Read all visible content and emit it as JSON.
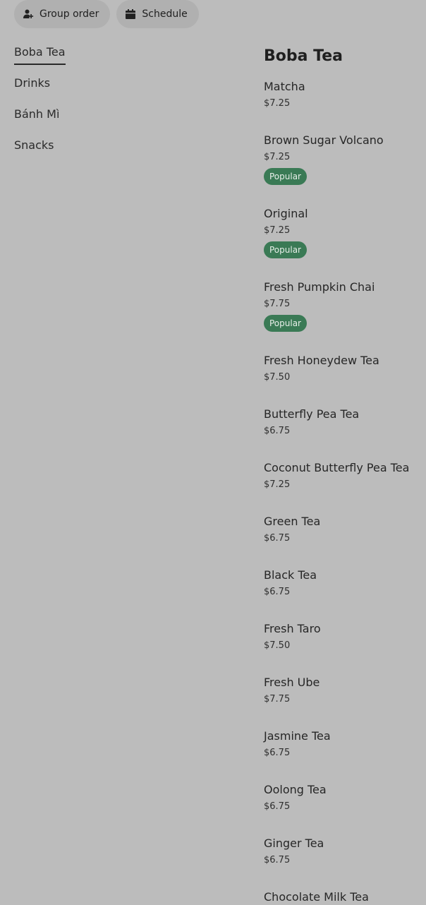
{
  "header": {
    "group_order_label": "Group order",
    "schedule_label": "Schedule"
  },
  "sidebar": {
    "items": [
      {
        "label": "Boba Tea",
        "active": true
      },
      {
        "label": "Drinks",
        "active": false
      },
      {
        "label": "Bánh Mì",
        "active": false
      },
      {
        "label": "Snacks",
        "active": false
      }
    ]
  },
  "menu": {
    "section_title": "Boba Tea",
    "items": [
      {
        "name": "Matcha",
        "price": "$7.25",
        "badge": ""
      },
      {
        "name": "Brown Sugar Volcano",
        "price": "$7.25",
        "badge": "Popular"
      },
      {
        "name": "Original",
        "price": "$7.25",
        "badge": "Popular"
      },
      {
        "name": "Fresh Pumpkin Chai",
        "price": "$7.75",
        "badge": "Popular"
      },
      {
        "name": "Fresh Honeydew Tea",
        "price": "$7.50",
        "badge": ""
      },
      {
        "name": "Butterfly Pea Tea",
        "price": "$6.75",
        "badge": ""
      },
      {
        "name": "Coconut Butterfly Pea Tea",
        "price": "$7.25",
        "badge": ""
      },
      {
        "name": "Green Tea",
        "price": "$6.75",
        "badge": ""
      },
      {
        "name": "Black Tea",
        "price": "$6.75",
        "badge": ""
      },
      {
        "name": "Fresh Taro",
        "price": "$7.50",
        "badge": ""
      },
      {
        "name": "Fresh Ube",
        "price": "$7.75",
        "badge": ""
      },
      {
        "name": "Jasmine Tea",
        "price": "$6.75",
        "badge": ""
      },
      {
        "name": "Oolong Tea",
        "price": "$6.75",
        "badge": ""
      },
      {
        "name": "Ginger Tea",
        "price": "$6.75",
        "badge": ""
      },
      {
        "name": "Chocolate Milk Tea",
        "price": "",
        "badge": ""
      }
    ]
  },
  "colors": {
    "background": "#bcbcbc",
    "badge_bg": "#3a7a55",
    "pill_bg": "#b0b0b0"
  },
  "icons": {
    "group_order": "person-add-icon",
    "schedule": "calendar-icon"
  }
}
